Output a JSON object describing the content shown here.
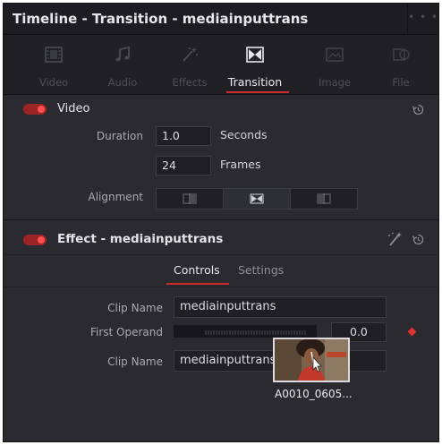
{
  "window": {
    "title": "Timeline - Transition - mediainputtrans",
    "menu_icon": "more-dots-icon"
  },
  "tabs": [
    {
      "label": "Video",
      "icon": "video-grid-icon",
      "active": false
    },
    {
      "label": "Audio",
      "icon": "music-note-icon",
      "active": false
    },
    {
      "label": "Effects",
      "icon": "magic-wand-icon",
      "active": false
    },
    {
      "label": "Transition",
      "icon": "transition-icon",
      "active": true
    },
    {
      "label": "Image",
      "icon": "image-icon",
      "active": false
    },
    {
      "label": "File",
      "icon": "file-icon",
      "active": false
    }
  ],
  "video_section": {
    "title": "Video",
    "enabled": true,
    "duration_label": "Duration",
    "duration_seconds": "1.0",
    "seconds_unit": "Seconds",
    "duration_frames": "24",
    "frames_unit": "Frames",
    "alignment_label": "Alignment",
    "alignment_options": [
      "start-on-edit-icon",
      "center-on-edit-icon",
      "end-on-edit-icon"
    ],
    "alignment_selected": "center-on-edit-icon"
  },
  "effect_section": {
    "title": "Effect - mediainputtrans",
    "enabled": true,
    "subtabs": {
      "controls": "Controls",
      "settings": "Settings",
      "active": "Controls"
    },
    "clip_name_label_1": "Clip Name",
    "clip_name_value_1": "mediainputtrans",
    "first_operand_label": "First Operand",
    "first_operand_value": "0.0",
    "clip_name_label_2": "Clip Name",
    "clip_name_value_2": "mediainputtrans"
  },
  "drag_preview": {
    "caption": "A0010_0605..."
  },
  "colors": {
    "accent_red": "#cf2b2b",
    "panel_bg": "#28282e",
    "title_bg": "#1c1c21"
  }
}
